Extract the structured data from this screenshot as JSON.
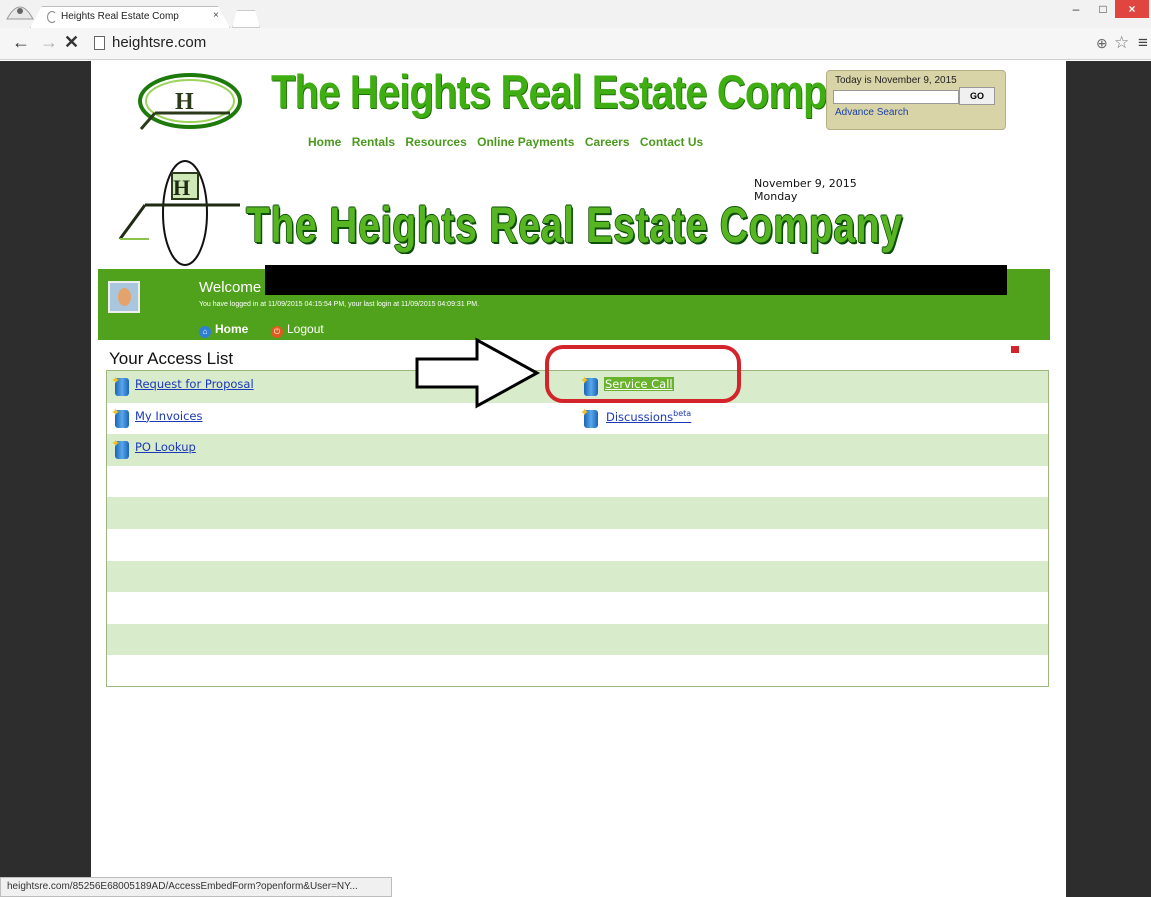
{
  "browser": {
    "tab_title": "Heights Real Estate Comp",
    "tab_close": "×",
    "url": "heightsre.com",
    "status_url": "heightsre.com/85256E68005189AD/AccessEmbedForm?openform&User=NY...",
    "window_controls": {
      "minimize": "–",
      "maximize": "□",
      "close": "×"
    },
    "nav": {
      "back": "←",
      "forward": "→",
      "stop": "✕"
    },
    "icons": {
      "zoom": "⊕",
      "star": "☆",
      "menu": "≡"
    }
  },
  "header": {
    "title": "The Heights Real Estate Company",
    "nav": [
      "Home",
      "Rentals",
      "Resources",
      "Online Payments",
      "Careers",
      "Contact Us"
    ],
    "big_title": "The Heights Real Estate Company"
  },
  "search": {
    "today": "Today is November 9, 2015",
    "go_label": "GO",
    "advance_link": "Advance Search"
  },
  "date_block": {
    "date": "November 9, 2015",
    "day": "Monday"
  },
  "welcome": {
    "label": "Welcome",
    "login_info": "You have logged in at 11/09/2015 04:15:54 PM, your last login at 11/09/2015 04:09:31 PM.",
    "home_label": "Home",
    "logout_label": "Logout"
  },
  "access": {
    "title": "Your Access List",
    "left_items": [
      "Request for Proposal",
      "My Invoices",
      "PO Lookup"
    ],
    "right_items": [
      "Service Call",
      "Discussions"
    ],
    "beta_label": "beta"
  },
  "colors": {
    "brand_green": "#3fae13",
    "welcome_bar": "#50a21c",
    "row_shade": "#d8ebcb",
    "annotation_red": "#d3232b"
  }
}
